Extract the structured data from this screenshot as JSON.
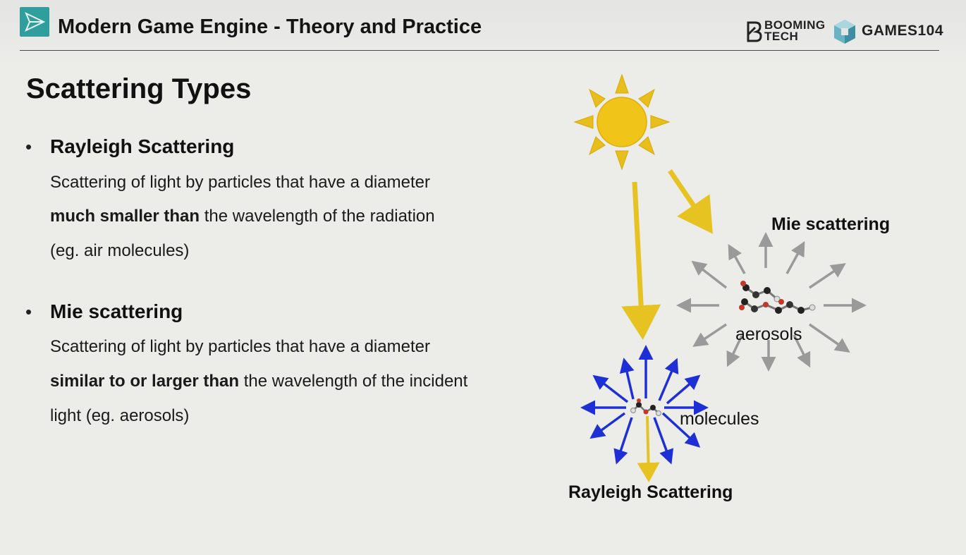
{
  "header": {
    "title": "Modern Game Engine - Theory and Practice",
    "brand1_line1": "BOOMING",
    "brand1_line2": "TECH",
    "brand2": "GAMES104"
  },
  "slide": {
    "title": "Scattering Types",
    "bullets": [
      {
        "heading": "Rayleigh Scattering",
        "line1": "Scattering of light by particles that have a diameter",
        "line2_bold": "much smaller than",
        "line2_rest": " the wavelength of the radiation",
        "line3": "(eg. air molecules)"
      },
      {
        "heading": "Mie scattering",
        "line1": "Scattering of light by particles that have a diameter",
        "line2_bold": "similar to or larger than",
        "line2_rest": " the wavelength of the incident",
        "line3": "light (eg. aerosols)"
      }
    ],
    "bullet_char": "•"
  },
  "diagram": {
    "mie_label": "Mie scattering",
    "aerosols_label": "aerosols",
    "molecules_label": "molecules",
    "rayleigh_label": "Rayleigh Scattering",
    "colors": {
      "sun": "#f0c419",
      "sun_ray": "#e8be1c",
      "light_arrow": "#e6c321",
      "rayleigh_arrows": "#1e2fd6",
      "mie_arrows": "#9a9a9a",
      "teal_logo": "#2f9e9c"
    }
  }
}
